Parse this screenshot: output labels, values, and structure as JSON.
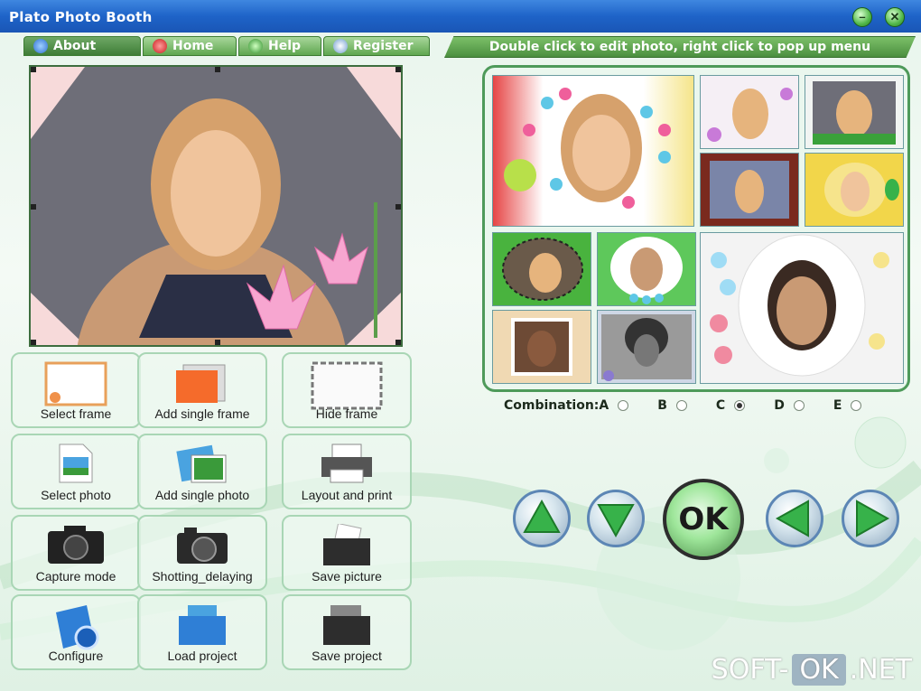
{
  "window": {
    "title": "Plato Photo Booth",
    "minimize_label": "–",
    "close_label": "✕"
  },
  "nav": {
    "tabs": [
      {
        "label": "About"
      },
      {
        "label": "Home"
      },
      {
        "label": "Help"
      },
      {
        "label": "Register"
      }
    ],
    "hint": "Double click to edit photo, right click to pop up menu"
  },
  "combination": {
    "label": "Combination:",
    "options": [
      "A",
      "B",
      "C",
      "D",
      "E"
    ],
    "selected": "C"
  },
  "buttons": [
    {
      "label": "Select frame"
    },
    {
      "label": "Add single frame"
    },
    {
      "label": "Hide frame"
    },
    {
      "label": "Select photo"
    },
    {
      "label": "Add single photo"
    },
    {
      "label": "Layout and print"
    },
    {
      "label": "Capture mode"
    },
    {
      "label": "Shotting_delaying"
    },
    {
      "label": "Save picture"
    },
    {
      "label": "Configure"
    },
    {
      "label": "Load project"
    },
    {
      "label": "Save project"
    }
  ],
  "ok_label": "OK",
  "watermark": {
    "left": "SOFT-",
    "mid": "OK",
    "right": ".NET"
  },
  "icons": {
    "about": "info-icon",
    "home": "home-icon",
    "help": "globe-icon",
    "register": "star-icon",
    "up": "arrow-up-icon",
    "down": "arrow-down-icon",
    "left": "arrow-left-icon",
    "right": "arrow-right-icon"
  },
  "colors": {
    "title_bar": "#1e63c8",
    "accent_green": "#4e9a5a",
    "nav_green": "#5fa64f"
  }
}
